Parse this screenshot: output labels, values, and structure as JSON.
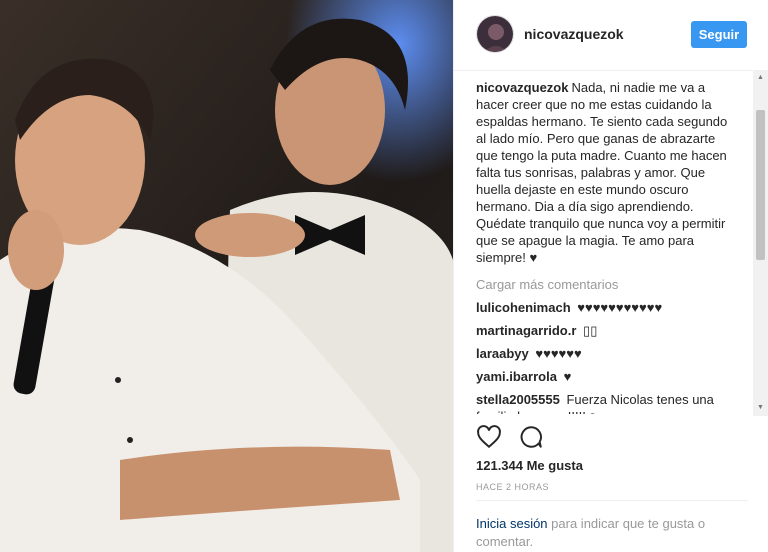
{
  "post": {
    "username": "nicovazquezok",
    "follow_label": "Seguir",
    "caption": "Nada, ni nadie me va a hacer creer que no me estas cuidando la espaldas hermano. Te siento cada segundo al lado mío. Pero que ganas de abrazarte que tengo la puta madre. Cuanto me hacen falta tus sonrisas, palabras y amor. Que huella dejaste en este mundo oscuro hermano. Dia a día sigo aprendiendo. Quédate tranquilo que nunca voy a permitir que se apague la magia. Te amo para siempre! ♥",
    "load_more": "Cargar más comentarios",
    "comments": [
      {
        "user": "lulicohenimach",
        "text": "♥♥♥♥♥♥♥♥♥♥♥"
      },
      {
        "user": "martinagarrido.r",
        "text": "▯▯"
      },
      {
        "user": "laraabyy",
        "text": "♥♥♥♥♥♥"
      },
      {
        "user": "yami.ibarrola",
        "text": "♥"
      },
      {
        "user": "stella2005555",
        "text": "Fuerza Nicolas tenes una familia hermosa!!!!!☺"
      }
    ],
    "likes": "121.344 Me gusta",
    "time": "HACE 2 HORAS",
    "login_link": "Inicia sesión",
    "login_text": "para indicar que te gusta o comentar."
  },
  "icons": {
    "like": "heart-icon",
    "comment": "comment-icon"
  }
}
